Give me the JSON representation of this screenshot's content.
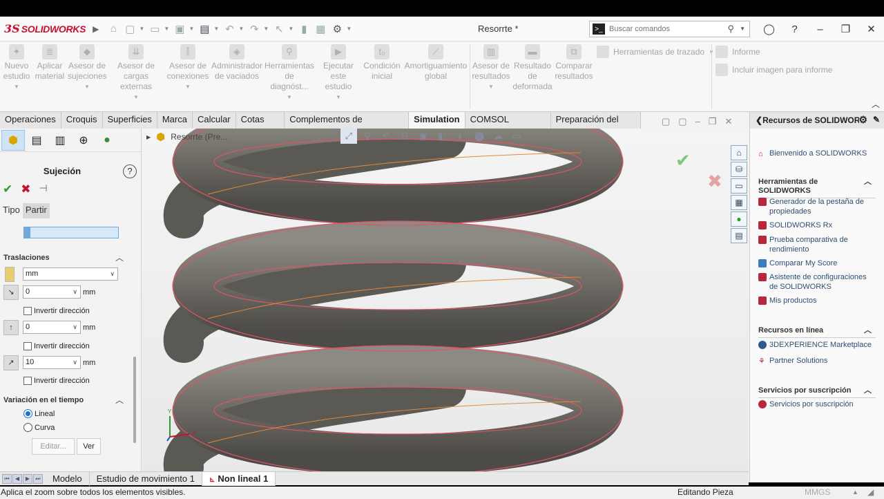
{
  "titlebar": {
    "logo_prefix": "3S",
    "logo_text": "SOLIDWORKS",
    "document_title": "Resorrte *",
    "search_placeholder": "Buscar comandos"
  },
  "ribbon": {
    "buttons": [
      {
        "label": "Nuevo\nestudio"
      },
      {
        "label": "Aplicar\nmaterial"
      },
      {
        "label": "Asesor de\nsujeciones"
      },
      {
        "label": "Asesor de\ncargas externas"
      },
      {
        "label": "Asesor de\nconexiones"
      },
      {
        "label": "Administrador\nde vaciados"
      },
      {
        "label": "Herramientas\nde diagnóst..."
      },
      {
        "label": "Ejecutar\neste estudio"
      },
      {
        "label": "Condición\ninicial"
      },
      {
        "label": "Amortiguamiento\nglobal"
      },
      {
        "label": "Asesor de\nresultados"
      },
      {
        "label": "Resultado\nde\ndeformada"
      },
      {
        "label": "Comparar\nresultados"
      }
    ],
    "trazado": "Herramientas de trazado",
    "informe": "Informe",
    "incluir": "Incluir imagen para informe"
  },
  "command_tabs": [
    "Operaciones",
    "Croquis",
    "Superficies",
    "Marca",
    "Calcular",
    "Cotas MBD",
    "Complementos de SOLIDWORKS",
    "Simulation",
    "COMSOL Multiphysics",
    "Preparación del análisis"
  ],
  "left_panel": {
    "title": "Sujeción",
    "subtabs": [
      "Tipo",
      "Partir"
    ],
    "traslaciones": "Traslaciones",
    "unit": "mm",
    "rows": [
      {
        "value": "0",
        "unit": "mm",
        "invert": "Invertir dirección"
      },
      {
        "value": "0",
        "unit": "mm",
        "invert": "Invertir dirección"
      },
      {
        "value": "10",
        "unit": "mm",
        "invert": "Invertir dirección"
      }
    ],
    "variacion": "Variación en el tiempo",
    "radio_lineal": "Lineal",
    "radio_curva": "Curva",
    "editar": "Editar...",
    "ver": "Ver"
  },
  "viewport": {
    "tree_label": "Resorrte (Pre..."
  },
  "right_panel": {
    "title": "Recursos de SOLIDWORKS",
    "welcome": "Bienvenido a SOLIDWORKS",
    "section_tools": "Herramientas de SOLIDWORKS",
    "tools": [
      "Generador de la pestaña de propiedades",
      "SOLIDWORKS Rx",
      "Prueba comparativa de rendimiento",
      "Comparar My Score",
      "Asistente de configuraciones de SOLIDWORKS",
      "Mis productos"
    ],
    "section_online": "Recursos en línea",
    "online": [
      "3DEXPERIENCE Marketplace",
      "Partner Solutions"
    ],
    "section_sub": "Servicios por suscripción",
    "sub": [
      "Servicios por suscripción"
    ]
  },
  "bottom_tabs": [
    "Modelo",
    "Estudio de movimiento 1",
    "Non lineal 1"
  ],
  "status": {
    "message": "Aplica el zoom sobre todos los elementos visibles.",
    "mode": "Editando Pieza",
    "units": "MMGS"
  },
  "colors": {
    "accent": "#c8102e",
    "selection": "#1a73c9",
    "spring": "#6f6c66"
  }
}
